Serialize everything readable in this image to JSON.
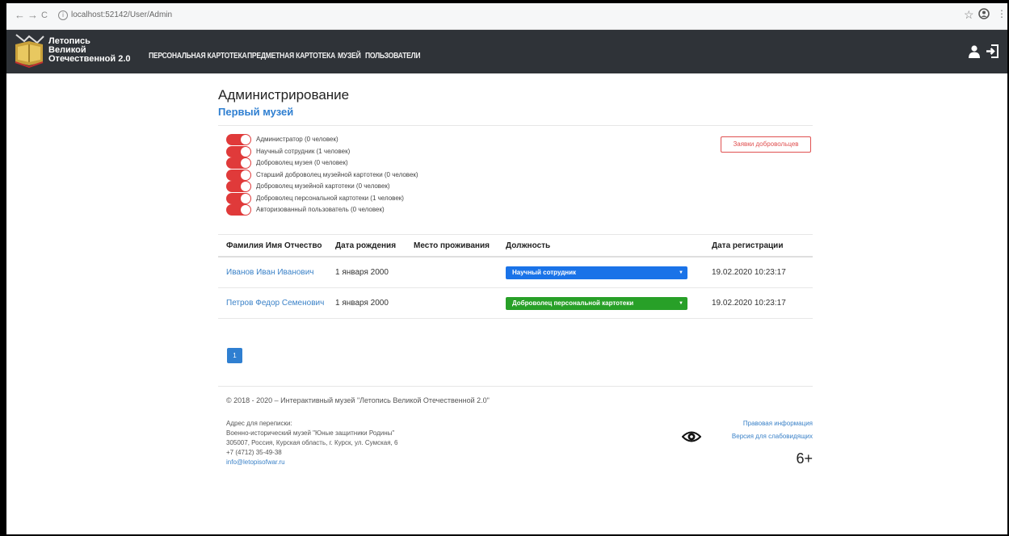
{
  "browser": {
    "back": "←",
    "forward": "→",
    "reload": "C",
    "url": "localhost:52142/User/Admin"
  },
  "header": {
    "logo_lines": [
      "Летопись",
      "Великой",
      "Отечественной 2.0"
    ],
    "nav": [
      "Персональная картотека",
      "Предметная картотека",
      "Музей",
      "Пользователи"
    ]
  },
  "page": {
    "title": "Администрирование",
    "museum": "Первый музей",
    "volunteer_requests": "Заявки добровольцев",
    "roles": [
      "Администратор (0 человек)",
      "Научный сотрудник (1 человек)",
      "Доброволец музея (0 человек)",
      "Старший доброволец музейной картотеки (0 человек)",
      "Доброволец музейной картотеки (0 человек)",
      "Доброволец персональной картотеки (1 человек)",
      "Авторизованный пользователь (0 человек)"
    ],
    "table": {
      "headers": [
        "Фамилия Имя Отчество",
        "Дата рождения",
        "Место проживания",
        "Должность",
        "Дата регистрации"
      ],
      "rows": [
        {
          "name": "Иванов Иван Иванович",
          "birth": "1 января 2000",
          "place": "",
          "position": "Научный сотрудник",
          "position_color": "#1a73e8",
          "registered": "19.02.2020 10:23:17"
        },
        {
          "name": "Петров Федор Семенович",
          "birth": "1 января 2000",
          "place": "",
          "position": "Доброволец персональной картотеки",
          "position_color": "#28a028",
          "registered": "19.02.2020 10:23:17"
        }
      ]
    },
    "pagination": [
      "1"
    ]
  },
  "footer": {
    "copyright": "© 2018 - 2020 – Интерактивный музей \"Летопись Великой Отечественной 2.0\"",
    "address_title": "Адрес для переписки:",
    "address_org": "Военно-исторический музей \"Юные защитники Родины\"",
    "address_street": "305007, Россия, Курская область, г. Курск, ул. Сумская, 6",
    "phone": "+7 (4712) 35-49-38",
    "email": "info@letopisofwar.ru",
    "legal": "Правовая информация",
    "vision": "Версия для слабовидящих",
    "age": "6+"
  },
  "colors": {
    "header_bg": "#2f3338",
    "accent": "#2f7fd1",
    "toggle": "#e03a3a",
    "danger": "#e05050"
  }
}
